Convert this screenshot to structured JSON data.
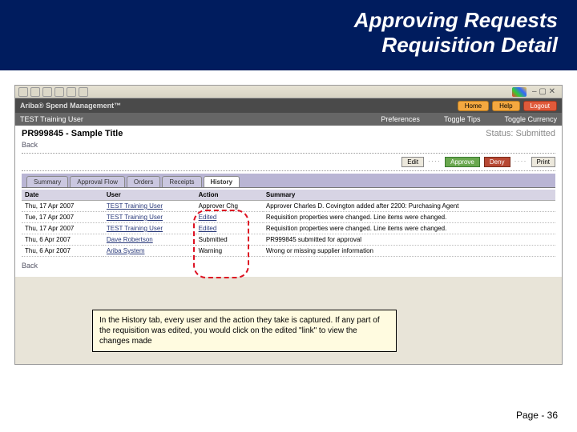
{
  "slide": {
    "title_line1": "Approving Requests",
    "title_line2": "Requisition Detail",
    "page_label": "Page - 36"
  },
  "ariba": {
    "brand": "Ariba® Spend Management™",
    "home": "Home",
    "help": "Help",
    "logout": "Logout"
  },
  "nav": {
    "user": "TEST Training User",
    "preferences": "Preferences",
    "tips": "Toggle Tips",
    "currency": "Toggle Currency"
  },
  "pr": {
    "id_title": "PR999845 - Sample Title",
    "status_label": "Status: Submitted",
    "back": "Back"
  },
  "actions": {
    "edit": "Edit",
    "approve": "Approve",
    "deny": "Deny",
    "print": "Print"
  },
  "tabs": {
    "summary": "Summary",
    "approval": "Approval Flow",
    "orders": "Orders",
    "receipts": "Receipts",
    "history": "History"
  },
  "table": {
    "cols": {
      "date": "Date",
      "user": "User",
      "action": "Action",
      "summary": "Summary"
    },
    "rows": [
      {
        "date": "Thu, 17 Apr 2007",
        "user": "TEST Training User",
        "action": "Approver Chg",
        "summary": "Approver Charles D. Covington added after 2200: Purchasing Agent"
      },
      {
        "date": "Tue, 17 Apr 2007",
        "user": "TEST Training User",
        "action": "Edited",
        "summary": "Requisition properties were changed. Line items were changed."
      },
      {
        "date": "Thu, 17 Apr 2007",
        "user": "TEST Training User",
        "action": "Edited",
        "summary": "Requisition properties were changed. Line items were changed."
      },
      {
        "date": "Thu, 6 Apr 2007",
        "user": "Dave Robertson",
        "action": "Submitted",
        "summary": "PR999845 submitted for approval"
      },
      {
        "date": "Thu, 6 Apr 2007",
        "user": "Ariba System",
        "action": "Warning",
        "summary": "Wrong or missing supplier information"
      }
    ]
  },
  "annotation": "In the History tab, every user and the action they take is captured. If any part of the requisition was edited, you would click on the edited \"link\" to view the changes made"
}
